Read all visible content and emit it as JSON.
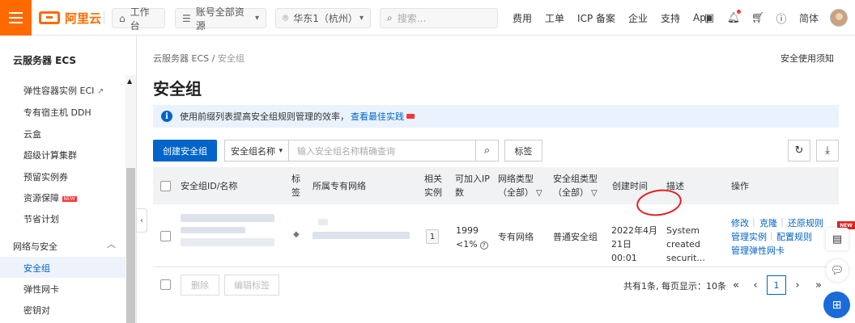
{
  "topbar": {
    "logo_text": "阿里云",
    "workbench": "工作台",
    "resources": "账号全部资源",
    "region": "华东1（杭州）",
    "search_placeholder": "搜索...",
    "links": [
      "费用",
      "工单",
      "ICP 备案",
      "企业",
      "支持",
      "App"
    ],
    "lang": "简体"
  },
  "sidebar": {
    "title": "云服务器 ECS",
    "items": [
      "弹性容器实例 ECI",
      "专有宿主机 DDH",
      "云盒",
      "超级计算集群",
      "预留实例券",
      "资源保障",
      "节省计划"
    ],
    "new_badge": "NEW",
    "group": "网络与安全",
    "group_items": [
      "安全组",
      "弹性网卡",
      "密钥对"
    ]
  },
  "main": {
    "breadcrumb_root": "云服务器 ECS",
    "breadcrumb_sep": "/",
    "breadcrumb_current": "安全组",
    "help_link": "安全使用须知",
    "title": "安全组",
    "notice_text": "使用前缀列表提高安全组规则管理的效率，",
    "notice_link": "查看最佳实践",
    "create_button": "创建安全组",
    "search_field": "安全组名称",
    "search_placeholder": "输入安全组名称精确查询",
    "tag_button": "标签"
  },
  "table": {
    "headers": {
      "id_name": "安全组ID/名称",
      "tag": "标签",
      "vpc": "所属专有网络",
      "instances": "相关实例",
      "available_ip": "可加入IP数",
      "network_type": "网络类型（全部）",
      "sg_type": "安全组类型（全部）",
      "created": "创建时间",
      "description": "描述",
      "actions": "操作"
    },
    "row": {
      "instances": "1",
      "available_ip": "1999",
      "available_pct": "<1%",
      "network_type": "专有网络",
      "sg_type": "普通安全组",
      "created": "2022年4月21日 00:01",
      "description": "System created securit...",
      "actions": {
        "modify": "修改",
        "clone": "克隆",
        "restore": "还原规则",
        "manage_instances": "管理实例",
        "config_rules": "配置规则",
        "manage_eni": "管理弹性网卡"
      }
    }
  },
  "footer": {
    "delete_button": "删除",
    "edit_tags_button": "编辑标签",
    "pager_text": "共有1条, 每页显示：10条",
    "current_page": "1"
  },
  "float": {
    "new_badge": "NEW"
  },
  "colors": {
    "brand": "#ff6a00",
    "primary": "#0064c8",
    "highlight_circle": "#e02020"
  }
}
